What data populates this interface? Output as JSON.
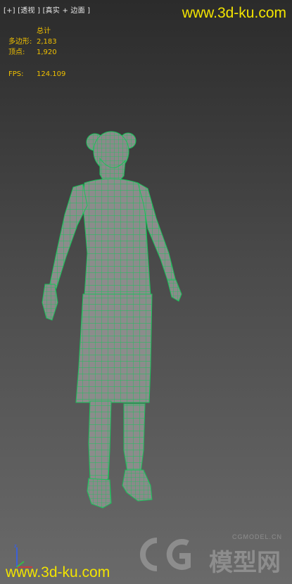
{
  "viewport": {
    "plus": "[+]",
    "view": "[透视 ]",
    "shading": "[真实 + 边面 ]"
  },
  "stats": {
    "header": "总计",
    "polys_label": "多边形:",
    "polys_value": "2,183",
    "verts_label": "顶点:",
    "verts_value": "1,920",
    "fps_label": "FPS:",
    "fps_value": "124.109"
  },
  "watermarks": {
    "top": "www.3d-ku.com",
    "bottom": "www.3d-ku.com",
    "cg_small": "CGMODEL.CN",
    "cg_big": "模型网"
  },
  "colors": {
    "stats": "#f0c000",
    "watermark": "#f2e400",
    "wire": "#19c45a",
    "surface": "#8a8a8a"
  },
  "icons": {
    "axis": "axis-gizmo-icon",
    "logo": "cg-logo-icon"
  }
}
